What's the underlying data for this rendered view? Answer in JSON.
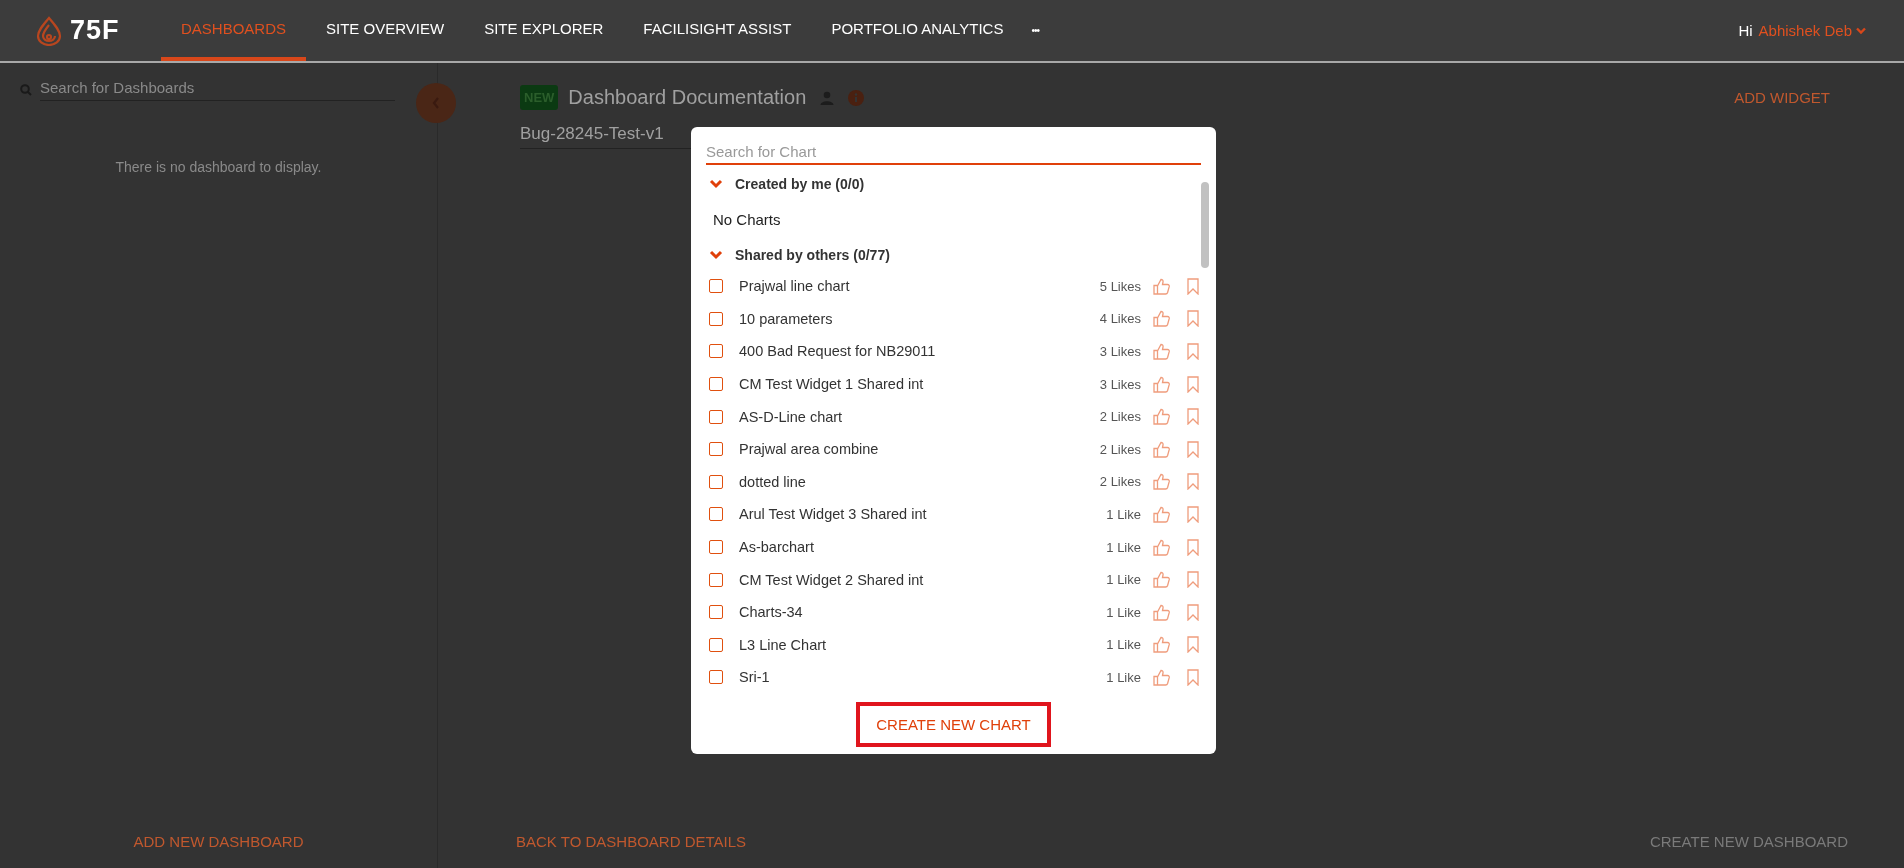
{
  "header": {
    "logo": "75F",
    "nav": [
      {
        "label": "DASHBOARDS",
        "selected": true
      },
      {
        "label": "SITE OVERVIEW",
        "selected": false
      },
      {
        "label": "SITE EXPLORER",
        "selected": false
      },
      {
        "label": "FACILISIGHT ASSIST",
        "selected": false
      },
      {
        "label": "PORTFOLIO ANALYTICS",
        "selected": false
      }
    ],
    "more": "•••",
    "greeting": "Hi",
    "user": "Abhishek Deb"
  },
  "sidebar": {
    "search": {
      "placeholder": "Search for Dashboards"
    },
    "empty_message": "There is no dashboard to display.",
    "add_button": "ADD NEW DASHBOARD"
  },
  "main": {
    "badge": "NEW",
    "title": "Dashboard Documentation",
    "name_field": {
      "value": "Bug-28245-Test-v1"
    },
    "add_widget": "ADD WIDGET",
    "back_button": "BACK TO DASHBOARD DETAILS",
    "create_button": {
      "label": "CREATE NEW DASHBOARD",
      "disabled": true
    }
  },
  "modal": {
    "search": {
      "placeholder": "Search for Chart"
    },
    "sections": [
      {
        "title": "Created by me (0/0)",
        "expanded": true,
        "empty_text": "No Charts"
      },
      {
        "title": "Shared by others (0/77)",
        "expanded": true,
        "items": [
          {
            "name": "Prajwal line chart",
            "likes": "5 Likes",
            "checked": false
          },
          {
            "name": "10 parameters",
            "likes": "4 Likes",
            "checked": false
          },
          {
            "name": "400 Bad Request for NB29011",
            "likes": "3 Likes",
            "checked": false
          },
          {
            "name": "CM Test Widget 1 Shared int",
            "likes": "3 Likes",
            "checked": false
          },
          {
            "name": "AS-D-Line chart",
            "likes": "2 Likes",
            "checked": false
          },
          {
            "name": "Prajwal area combine",
            "likes": "2 Likes",
            "checked": false
          },
          {
            "name": "dotted line",
            "likes": "2 Likes",
            "checked": false
          },
          {
            "name": "Arul Test Widget 3 Shared int",
            "likes": "1 Like",
            "checked": false
          },
          {
            "name": "As-barchart",
            "likes": "1 Like",
            "checked": false
          },
          {
            "name": "CM Test Widget 2 Shared int",
            "likes": "1 Like",
            "checked": false
          },
          {
            "name": "Charts-34",
            "likes": "1 Like",
            "checked": false
          },
          {
            "name": "L3 Line Chart",
            "likes": "1 Like",
            "checked": false
          },
          {
            "name": "Sri-1",
            "likes": "1 Like",
            "checked": false
          }
        ]
      }
    ],
    "create_button": "CREATE NEW CHART"
  }
}
